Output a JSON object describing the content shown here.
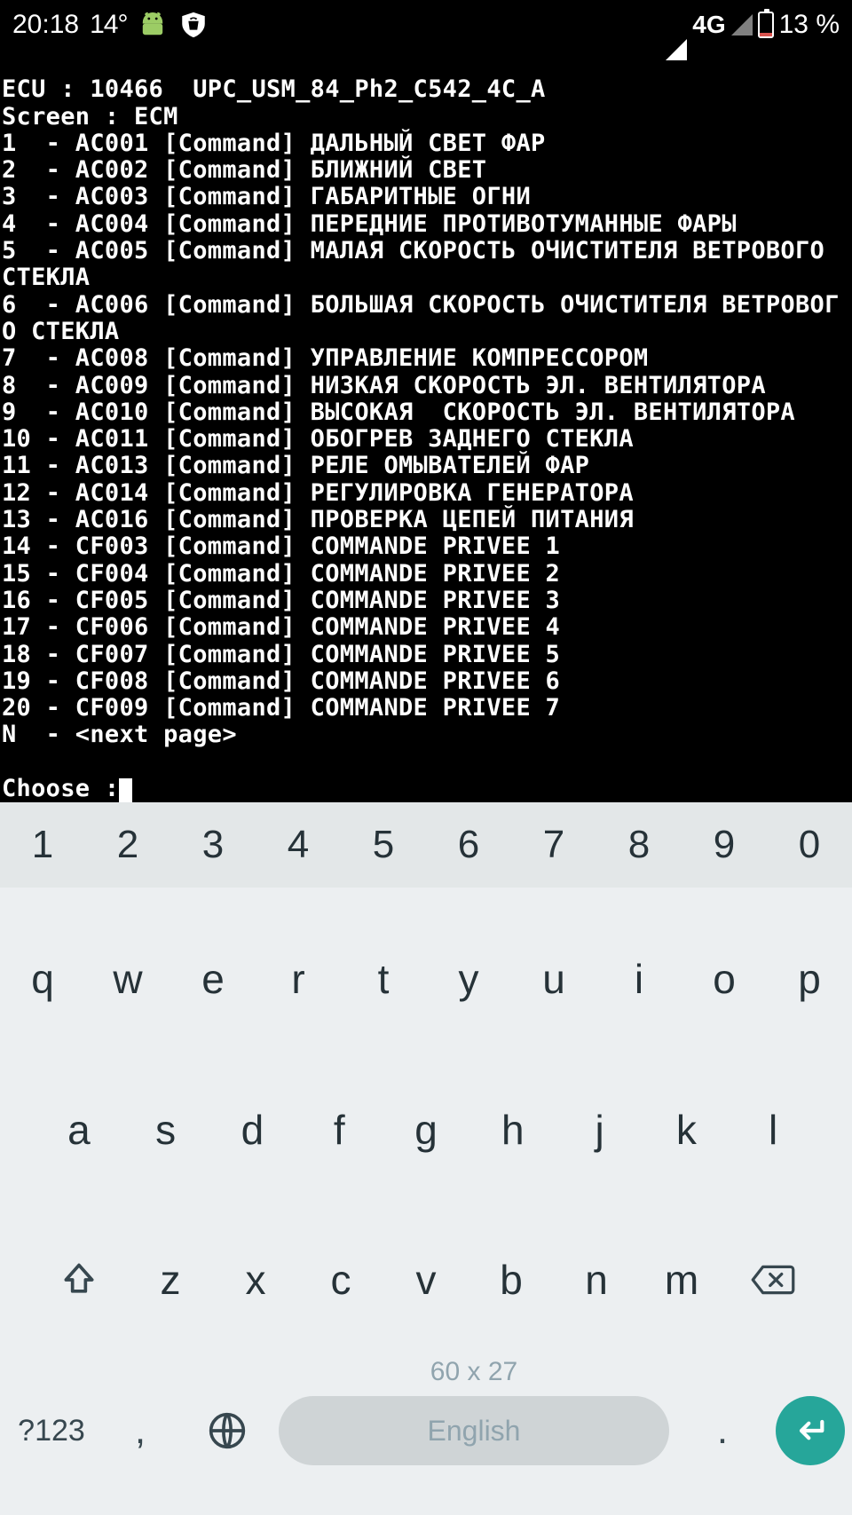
{
  "status": {
    "time": "20:18",
    "temp": "14°",
    "network": "4G",
    "battery": "13 %"
  },
  "terminal": {
    "ecu_line": "ECU : 10466  UPC_USM_84_Ph2_C542_4C_A",
    "screen_line": "Screen : ECM",
    "items": [
      "1  - AC001 [Command] ДАЛЬНЫЙ СВЕТ ФАР",
      "2  - AC002 [Command] БЛИЖНИЙ СВЕТ",
      "3  - AC003 [Command] ГАБАРИТНЫЕ ОГНИ",
      "4  - AC004 [Command] ПЕРЕДНИЕ ПРОТИВОТУМАННЫЕ ФАРЫ",
      "5  - AC005 [Command] МАЛАЯ СКОРОСТЬ ОЧИСТИТЕЛЯ ВЕТРОВОГО СТЕКЛА",
      "6  - AC006 [Command] БОЛЬШАЯ СКОРОСТЬ ОЧИСТИТЕЛЯ ВЕТРОВОГО СТЕКЛА",
      "7  - AC008 [Command] УПРАВЛЕНИЕ КОМПРЕССОРОМ",
      "8  - AC009 [Command] НИЗКАЯ СКОРОСТЬ ЭЛ. ВЕНТИЛЯТОРА",
      "9  - AC010 [Command] ВЫСОКАЯ  СКОРОСТЬ ЭЛ. ВЕНТИЛЯТОРА",
      "10 - AC011 [Command] ОБОГРЕВ ЗАДНЕГО СТЕКЛА",
      "11 - AC013 [Command] РЕЛЕ ОМЫВАТЕЛЕЙ ФАР",
      "12 - AC014 [Command] РЕГУЛИРОВКА ГЕНЕРАТОРА",
      "13 - AC016 [Command] ПРОВЕРКА ЦЕПЕЙ ПИТАНИЯ",
      "14 - CF003 [Command] COMMANDE PRIVEE 1",
      "15 - CF004 [Command] COMMANDE PRIVEE 2",
      "16 - CF005 [Command] COMMANDE PRIVEE 3",
      "17 - CF006 [Command] COMMANDE PRIVEE 4",
      "18 - CF007 [Command] COMMANDE PRIVEE 5",
      "19 - CF008 [Command] COMMANDE PRIVEE 6",
      "20 - CF009 [Command] COMMANDE PRIVEE 7",
      "N  - <next page>"
    ],
    "prompt": "Choose :"
  },
  "keyboard": {
    "nums": [
      "1",
      "2",
      "3",
      "4",
      "5",
      "6",
      "7",
      "8",
      "9",
      "0"
    ],
    "row1": [
      "q",
      "w",
      "e",
      "r",
      "t",
      "y",
      "u",
      "i",
      "o",
      "p"
    ],
    "row2": [
      "a",
      "s",
      "d",
      "f",
      "g",
      "h",
      "j",
      "k",
      "l"
    ],
    "row3": [
      "z",
      "x",
      "c",
      "v",
      "b",
      "n",
      "m"
    ],
    "symKey": "?123",
    "comma": ",",
    "period": ".",
    "dimensions": "60 x 27",
    "language": "English"
  }
}
